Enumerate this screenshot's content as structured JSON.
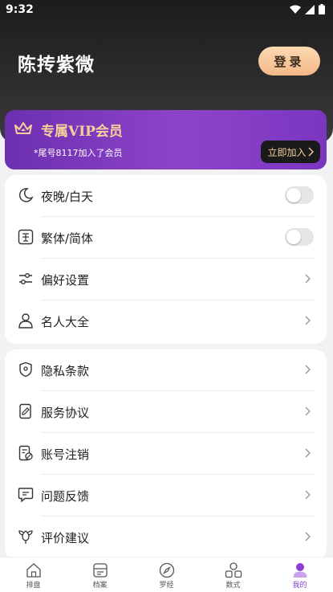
{
  "status": {
    "time": "9:32"
  },
  "profile": {
    "name": "陈抟紫微",
    "login_label": "登录"
  },
  "vip": {
    "title": "专属VIP会员",
    "subtitle": "*尾号8117加入了会员",
    "join_label": "立即加入",
    "accent": "#f6cf9a"
  },
  "settings": [
    {
      "label": "夜晚/白天",
      "icon": "moon-icon",
      "control": "toggle",
      "on": false
    },
    {
      "label": "繁体/简体",
      "icon": "traditional-char-icon",
      "control": "toggle",
      "on": false
    },
    {
      "label": "偏好设置",
      "icon": "sliders-icon",
      "control": "chevron"
    },
    {
      "label": "名人大全",
      "icon": "person-icon",
      "control": "chevron"
    }
  ],
  "more": [
    {
      "label": "隐私条款",
      "icon": "shield-icon"
    },
    {
      "label": "服务协议",
      "icon": "document-icon"
    },
    {
      "label": "账号注销",
      "icon": "account-cancel-icon"
    },
    {
      "label": "问题反馈",
      "icon": "message-icon"
    },
    {
      "label": "评价建议",
      "icon": "flower-icon"
    }
  ],
  "tabs": [
    {
      "label": "排盘",
      "icon": "home-icon"
    },
    {
      "label": "档案",
      "icon": "archive-icon"
    },
    {
      "label": "罗经",
      "icon": "compass-icon"
    },
    {
      "label": "数式",
      "icon": "grid-icon"
    },
    {
      "label": "我的",
      "icon": "user-icon",
      "active": true
    }
  ],
  "colors": {
    "brand": "#8a3fd1",
    "header": "#2a2a2b"
  }
}
